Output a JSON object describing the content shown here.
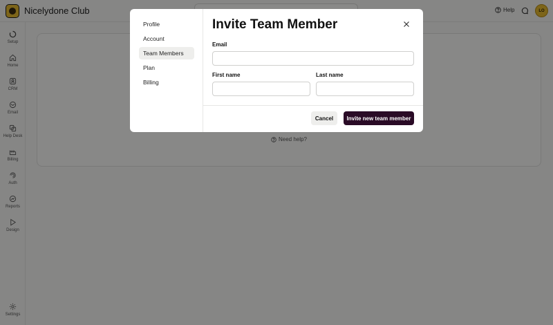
{
  "app": {
    "title": "Nicelydone Club",
    "avatar_initials": "LO"
  },
  "header": {
    "help_label": "Help"
  },
  "sidebar": {
    "items": [
      {
        "label": "Setup",
        "icon": "setup-icon"
      },
      {
        "label": "Home",
        "icon": "home-icon"
      },
      {
        "label": "CRM",
        "icon": "crm-icon"
      },
      {
        "label": "Email",
        "icon": "email-icon"
      },
      {
        "label": "Help Desk",
        "icon": "help-desk-icon"
      },
      {
        "label": "Billing",
        "icon": "billing-icon"
      },
      {
        "label": "Auth",
        "icon": "auth-icon"
      },
      {
        "label": "Reports",
        "icon": "reports-icon"
      },
      {
        "label": "Design",
        "icon": "design-icon"
      },
      {
        "label": "Settings",
        "icon": "settings-icon"
      }
    ]
  },
  "main": {
    "need_help": "Need help?"
  },
  "modal": {
    "nav": [
      {
        "label": "Profile",
        "active": false
      },
      {
        "label": "Account",
        "active": false
      },
      {
        "label": "Team Members",
        "active": true
      },
      {
        "label": "Plan",
        "active": false
      },
      {
        "label": "Billing",
        "active": false
      }
    ],
    "title": "Invite Team Member",
    "email_label": "Email",
    "email_value": "",
    "first_name_label": "First name",
    "first_name_value": "",
    "last_name_label": "Last name",
    "last_name_value": "",
    "cancel_label": "Cancel",
    "invite_label": "Invite new team member"
  },
  "colors": {
    "brand": "#e3b930",
    "primary_button": "#2a0b26"
  }
}
